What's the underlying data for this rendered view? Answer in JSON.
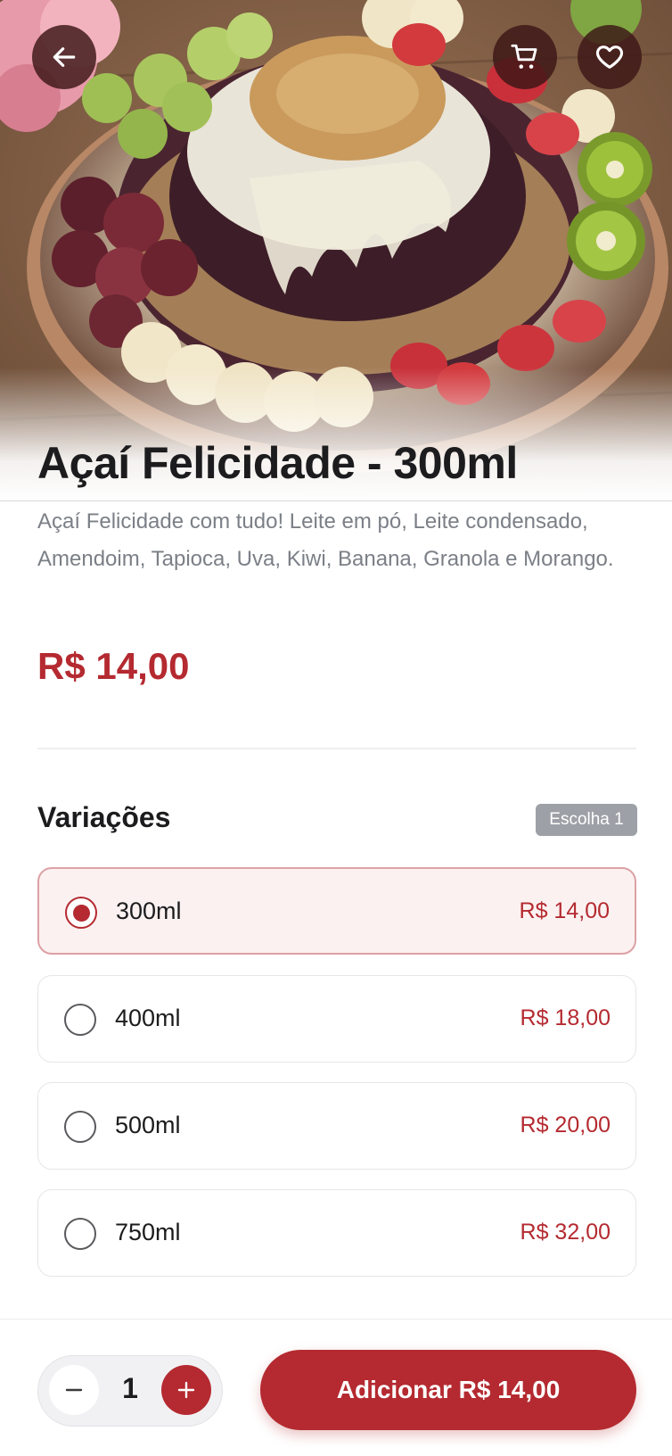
{
  "product": {
    "title": "Açaí Felicidade - 300ml",
    "description": "Açaí Felicidade com tudo! Leite em pó, Leite condensado, Amendoim, Tapioca, Uva, Kiwi, Banana, Granola e Morango.",
    "price": "R$ 14,00"
  },
  "header": {
    "back_icon": "arrow-left-icon",
    "cart_icon": "cart-icon",
    "favorite_icon": "heart-icon"
  },
  "variations": {
    "title": "Variações",
    "badge": "Escolha 1",
    "options": [
      {
        "label": "300ml",
        "price": "R$ 14,00",
        "selected": true
      },
      {
        "label": "400ml",
        "price": "R$ 18,00",
        "selected": false
      },
      {
        "label": "500ml",
        "price": "R$ 20,00",
        "selected": false
      },
      {
        "label": "750ml",
        "price": "R$ 32,00",
        "selected": false
      }
    ]
  },
  "cart_bar": {
    "quantity": "1",
    "add_label": "Adicionar R$ 14,00"
  },
  "colors": {
    "accent": "#b42a30",
    "selected_bg": "#fcf1f1",
    "badge_bg": "#9da0a6"
  }
}
